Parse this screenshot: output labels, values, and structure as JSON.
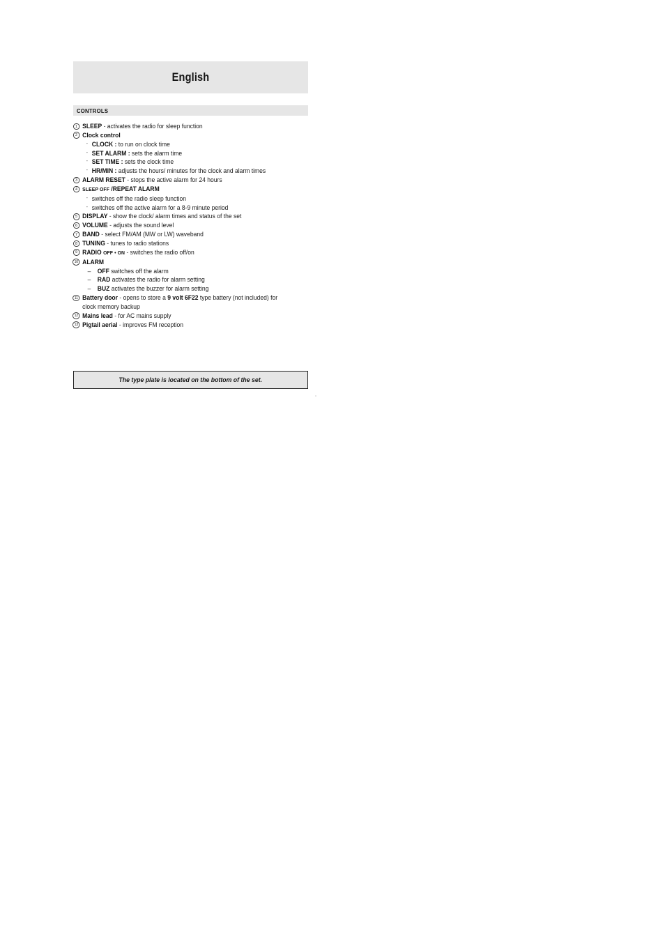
{
  "header": {
    "language_title": "English"
  },
  "section": {
    "title": "CONTROLS"
  },
  "controls": [
    {
      "number": "1",
      "term": "SLEEP",
      "separator": "-",
      "description": "activates the radio for sleep function"
    },
    {
      "number": "2",
      "term": "Clock control",
      "separator": "",
      "description": "",
      "subitems": [
        {
          "bullet": "-",
          "term": "CLOCK :",
          "description": "to run on clock time"
        },
        {
          "bullet": "-",
          "term": "SET ALARM :",
          "description": "sets the alarm time"
        },
        {
          "bullet": "-",
          "term": "SET TIME :",
          "description": "sets the clock time"
        },
        {
          "bullet": "-",
          "term": "HR/MIN :",
          "description": "adjusts the hours/ minutes for the clock and alarm times"
        }
      ]
    },
    {
      "number": "3",
      "term": "ALARM RESET",
      "separator": "-",
      "description": "stops the active alarm for 24 hours"
    },
    {
      "number": "4",
      "term_smallcaps": "SLEEP OFF",
      "term": "/REPEAT ALARM",
      "separator": "",
      "description": "",
      "subitems": [
        {
          "bullet": "-",
          "term": "",
          "description": "switches off the radio sleep function"
        },
        {
          "bullet": "-",
          "term": "",
          "description": "switches off the active alarm for a 8-9 minute period"
        }
      ]
    },
    {
      "number": "5",
      "term": "DISPLAY",
      "separator": "-",
      "description": "show the clock/ alarm times and status of the set"
    },
    {
      "number": "6",
      "term": "VOLUME",
      "separator": "-",
      "description": "adjusts the sound level"
    },
    {
      "number": "7",
      "term": "BAND",
      "separator": "-",
      "description": "select FM/AM (MW or LW) waveband"
    },
    {
      "number": "8",
      "term": "TUNING",
      "separator": "-",
      "description": "tunes to radio stations"
    },
    {
      "number": "9",
      "term": "RADIO",
      "term_smallcaps_after": "OFF • ON",
      "separator": "-",
      "description": "switches the radio off/on"
    },
    {
      "number": "10",
      "term": "ALARM",
      "separator": "",
      "description": "",
      "subitems": [
        {
          "bullet": "–",
          "term": "OFF",
          "description": "switches off the alarm"
        },
        {
          "bullet": "–",
          "term": "RAD",
          "description": "activates the radio for alarm setting"
        },
        {
          "bullet": "–",
          "term": "BUZ",
          "description": "activates the buzzer for alarm setting"
        }
      ]
    },
    {
      "number": "11",
      "term": "Battery door",
      "separator": "-",
      "description": "opens to store a ",
      "description_bold": "9 volt 6F22",
      "description_after": " type battery (not included) for",
      "description_line2": "clock memory backup"
    },
    {
      "number": "12",
      "term": "Mains lead",
      "separator": "-",
      "description": "for AC mains supply"
    },
    {
      "number": "13",
      "term": "Pigtail aerial",
      "separator": "-",
      "description": "improves FM reception"
    }
  ],
  "typeplate": {
    "note": "The type plate is located on the bottom of the set."
  }
}
